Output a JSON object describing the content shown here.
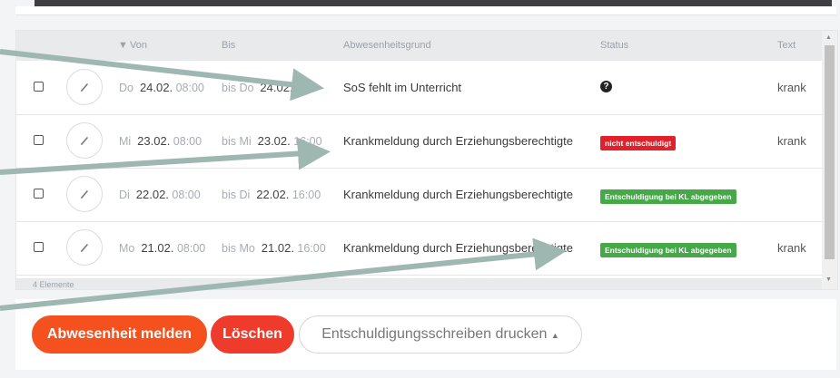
{
  "table": {
    "headers": {
      "von": "Von",
      "bis": "Bis",
      "grund": "Abwesenheitsgrund",
      "status": "Status",
      "text": "Text"
    },
    "rows": [
      {
        "von_day": "Do",
        "von_date": "24.02.",
        "von_time": "08:00",
        "bis_day": "bis Do",
        "bis_date": "24.02.",
        "bis_time": "",
        "grund": "SoS fehlt im Unterricht",
        "status": "",
        "status_type": "unknown",
        "text": "krank"
      },
      {
        "von_day": "Mi",
        "von_date": "23.02.",
        "von_time": "08:00",
        "bis_day": "bis Mi",
        "bis_date": "23.02.",
        "bis_time": "16:00",
        "grund": "Krankmeldung durch Erziehungsberechtigte",
        "status": "nicht entschuldigt",
        "status_type": "red",
        "text": "krank"
      },
      {
        "von_day": "Di",
        "von_date": "22.02.",
        "von_time": "08:00",
        "bis_day": "bis Di",
        "bis_date": "22.02.",
        "bis_time": "16:00",
        "grund": "Krankmeldung durch Erziehungsberechtigte",
        "status": "Entschuldigung bei KL abgegeben",
        "status_type": "green",
        "text": ""
      },
      {
        "von_day": "Mo",
        "von_date": "21.02.",
        "von_time": "08:00",
        "bis_day": "bis Mo",
        "bis_date": "21.02.",
        "bis_time": "16:00",
        "grund": "Krankmeldung durch Erziehungsberechtigte",
        "status": "Entschuldigung bei KL abgegeben",
        "status_type": "green",
        "text": "krank"
      }
    ],
    "footer_text": "4 Elemente"
  },
  "actions": {
    "report": "Abwesenheit melden",
    "delete": "Löschen",
    "print": "Entschuldigungsschreiben drucken"
  },
  "colors": {
    "orange": "#f4511e",
    "red": "#e0212b",
    "green": "#45a947",
    "arrow": "#9fb7b1"
  },
  "icons": {
    "edit": "pencil-icon",
    "sort": "sort-down-icon",
    "unknown_status": "question-circle-icon",
    "print_menu": "caret-up-icon"
  }
}
